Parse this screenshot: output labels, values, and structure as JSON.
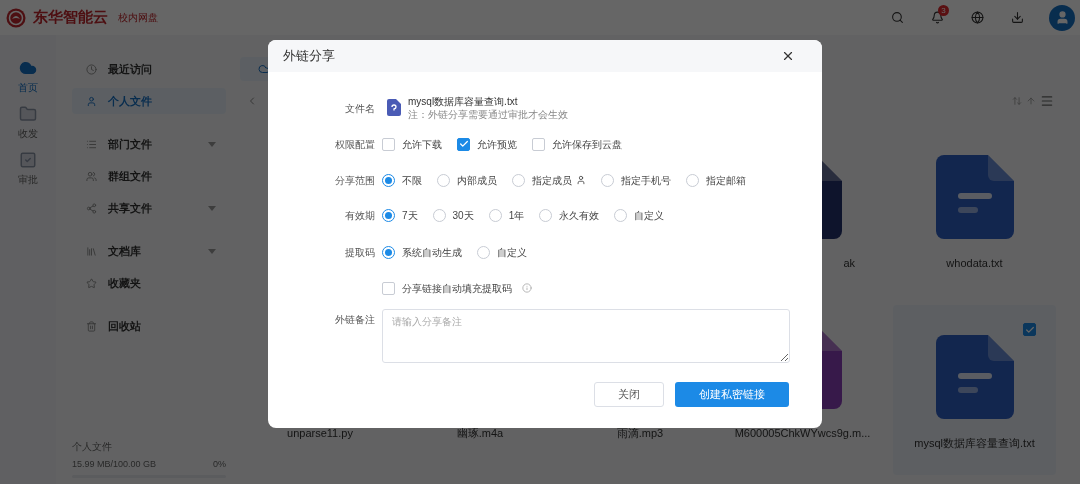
{
  "header": {
    "logo_text": "东华智能云",
    "logo_subtitle": "校内网盘",
    "notification_count": "3"
  },
  "rail": [
    {
      "label": "首页",
      "selected": true
    },
    {
      "label": "收发",
      "selected": false
    },
    {
      "label": "审批",
      "selected": false
    }
  ],
  "sidebar": {
    "sections": [
      [
        {
          "label": "最近访问",
          "selected": false,
          "expandable": false
        },
        {
          "label": "个人文件",
          "selected": true,
          "expandable": false
        }
      ],
      [
        {
          "label": "部门文件",
          "selected": false,
          "expandable": true
        },
        {
          "label": "群组文件",
          "selected": false,
          "expandable": false
        },
        {
          "label": "共享文件",
          "selected": false,
          "expandable": true
        }
      ],
      [
        {
          "label": "文档库",
          "selected": false,
          "expandable": true
        },
        {
          "label": "收藏夹",
          "selected": false,
          "expandable": false
        }
      ],
      [
        {
          "label": "回收站",
          "selected": false,
          "expandable": false
        }
      ]
    ],
    "storage": {
      "label": "个人文件",
      "usage": "15.99 MB/100.00 GB",
      "percent": "0%",
      "level": 0.0002
    }
  },
  "files": [
    {
      "name": "ak",
      "kind": "dark",
      "selected": false
    },
    {
      "name": "whodata.txt",
      "kind": "doc",
      "selected": false
    },
    {
      "name": "unparse11.py",
      "kind": "hidden",
      "selected": false
    },
    {
      "name": "幽琢.m4a",
      "kind": "hidden",
      "selected": false
    },
    {
      "name": "雨滴.mp3",
      "kind": "hidden",
      "selected": false
    },
    {
      "name": "M600005ChkWYwcs9g.m...",
      "kind": "purple",
      "selected": false
    },
    {
      "name": "mysql数据库容量查询.txt",
      "kind": "doc",
      "selected": true
    }
  ],
  "dialog": {
    "title": "外链分享",
    "file": {
      "label": "文件名",
      "name": "mysql数据库容量查询.txt",
      "note": "注：外链分享需要通过审批才会生效"
    },
    "permissions": {
      "label": "权限配置",
      "options": [
        {
          "label": "允许下载",
          "checked": false
        },
        {
          "label": "允许预览",
          "checked": true
        },
        {
          "label": "允许保存到云盘",
          "checked": false
        }
      ]
    },
    "scope": {
      "label": "分享范围",
      "options": [
        {
          "label": "不限",
          "selected": true,
          "has_picker": false
        },
        {
          "label": "内部成员",
          "selected": false,
          "has_picker": false
        },
        {
          "label": "指定成员",
          "selected": false,
          "has_picker": true
        },
        {
          "label": "指定手机号",
          "selected": false,
          "has_picker": false
        },
        {
          "label": "指定邮箱",
          "selected": false,
          "has_picker": false
        }
      ]
    },
    "validity": {
      "label": "有效期",
      "options": [
        {
          "label": "7天",
          "selected": true
        },
        {
          "label": "30天",
          "selected": false
        },
        {
          "label": "1年",
          "selected": false
        },
        {
          "label": "永久有效",
          "selected": false
        },
        {
          "label": "自定义",
          "selected": false
        }
      ]
    },
    "code": {
      "label": "提取码",
      "options": [
        {
          "label": "系统自动生成",
          "selected": true
        },
        {
          "label": "自定义",
          "selected": false
        }
      ]
    },
    "autofill": {
      "label": "分享链接自动填充提取码",
      "checked": false
    },
    "remark": {
      "label": "外链备注",
      "placeholder": "请输入分享备注"
    },
    "buttons": [
      {
        "label": "关闭",
        "kind": "secondary"
      },
      {
        "label": "创建私密链接",
        "kind": "primary"
      }
    ]
  }
}
